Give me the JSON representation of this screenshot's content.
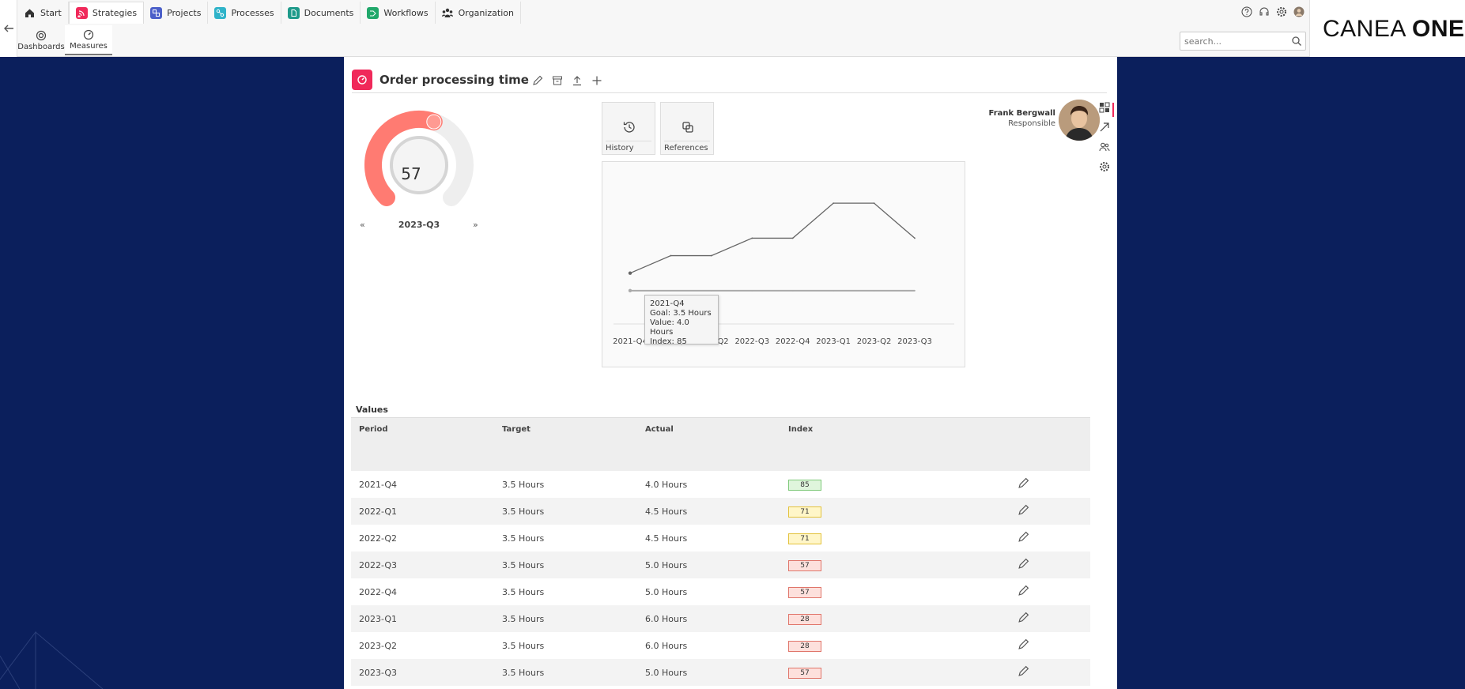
{
  "nav": {
    "tabs": [
      {
        "label": "Start",
        "icon": "home-icon"
      },
      {
        "label": "Strategies",
        "icon": "strategies-icon",
        "color": "#f0295a"
      },
      {
        "label": "Projects",
        "icon": "projects-icon",
        "color": "#4b5fc9"
      },
      {
        "label": "Processes",
        "icon": "processes-icon",
        "color": "#2fb3c9"
      },
      {
        "label": "Documents",
        "icon": "documents-icon",
        "color": "#1e9a8a"
      },
      {
        "label": "Workflows",
        "icon": "workflows-icon",
        "color": "#21a86b"
      },
      {
        "label": "Organization",
        "icon": "organization-icon"
      }
    ],
    "subtabs": [
      {
        "label": "Dashboards",
        "icon": "target-icon"
      },
      {
        "label": "Measures",
        "icon": "speedometer-icon"
      }
    ],
    "search_placeholder": "search...",
    "logo_light": "CANEA ",
    "logo_bold": "ONE"
  },
  "measure": {
    "title": "Order processing time",
    "accent": "#f0295a",
    "gauge": {
      "value": "57",
      "fraction": 0.57,
      "period": "2023-Q3",
      "prev": "«",
      "next": "»",
      "color": "#ff7b72"
    },
    "buttons": {
      "history": "History",
      "references": "References"
    },
    "responsible": {
      "name": "Frank Bergwall",
      "role": "Responsible"
    }
  },
  "chart_data": {
    "type": "line",
    "categories": [
      "2021-Q4",
      "2022-Q1",
      "2022-Q2",
      "2022-Q3",
      "2022-Q4",
      "2023-Q1",
      "2023-Q2",
      "2023-Q3"
    ],
    "series": [
      {
        "name": "Value",
        "values": [
          4.0,
          4.5,
          4.5,
          5.0,
          5.0,
          6.0,
          6.0,
          5.0
        ],
        "color": "#666666"
      },
      {
        "name": "Goal",
        "values": [
          3.5,
          3.5,
          3.5,
          3.5,
          3.5,
          3.5,
          3.5,
          3.5
        ],
        "color": "#aaaaaa"
      }
    ],
    "ylim": [
      3.0,
      6.5
    ],
    "grid": false,
    "tooltip": {
      "lines": [
        "2021-Q4",
        "Goal: 3.5 Hours",
        "Value: 4.0 Hours",
        "Index: 85"
      ]
    }
  },
  "table": {
    "label": "Values",
    "headers": [
      "Period",
      "Target",
      "Actual",
      "Index"
    ],
    "rows": [
      {
        "period": "2021-Q4",
        "target": "3.5 Hours",
        "actual": "4.0 Hours",
        "index": "85",
        "status": "green"
      },
      {
        "period": "2022-Q1",
        "target": "3.5 Hours",
        "actual": "4.5 Hours",
        "index": "71",
        "status": "yellow"
      },
      {
        "period": "2022-Q2",
        "target": "3.5 Hours",
        "actual": "4.5 Hours",
        "index": "71",
        "status": "yellow"
      },
      {
        "period": "2022-Q3",
        "target": "3.5 Hours",
        "actual": "5.0 Hours",
        "index": "57",
        "status": "red"
      },
      {
        "period": "2022-Q4",
        "target": "3.5 Hours",
        "actual": "5.0 Hours",
        "index": "57",
        "status": "red"
      },
      {
        "period": "2023-Q1",
        "target": "3.5 Hours",
        "actual": "6.0 Hours",
        "index": "28",
        "status": "red"
      },
      {
        "period": "2023-Q2",
        "target": "3.5 Hours",
        "actual": "6.0 Hours",
        "index": "28",
        "status": "red"
      },
      {
        "period": "2023-Q3",
        "target": "3.5 Hours",
        "actual": "5.0 Hours",
        "index": "57",
        "status": "red"
      }
    ]
  }
}
